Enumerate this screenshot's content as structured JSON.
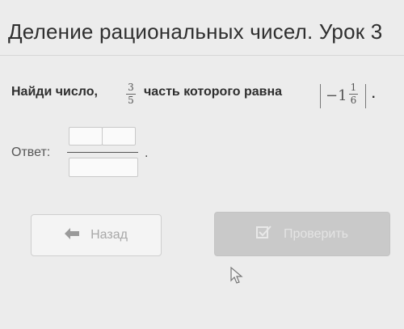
{
  "header": {
    "title": "Деление рациональных чисел. Урок 3"
  },
  "task": {
    "prefix": "Найди число,",
    "fraction": {
      "numerator": "3",
      "denominator": "5"
    },
    "middle": "часть которого равна",
    "mixed_number": {
      "sign_and_whole": "−1",
      "numerator": "1",
      "denominator": "6"
    },
    "suffix": "."
  },
  "answer": {
    "label": "Ответ:",
    "numerator_whole_value": "",
    "numerator_value": "",
    "denominator_value": "",
    "end_mark": "."
  },
  "buttons": {
    "back_label": "Назад",
    "check_label": "Проверить"
  },
  "icons": {
    "back": "arrow-left-icon",
    "check": "checkbox-icon",
    "cursor": "mouse-pointer-icon"
  },
  "colors": {
    "background": "#ececec",
    "check_button": "#c9c9c9",
    "back_button": "#f4f4f4"
  }
}
